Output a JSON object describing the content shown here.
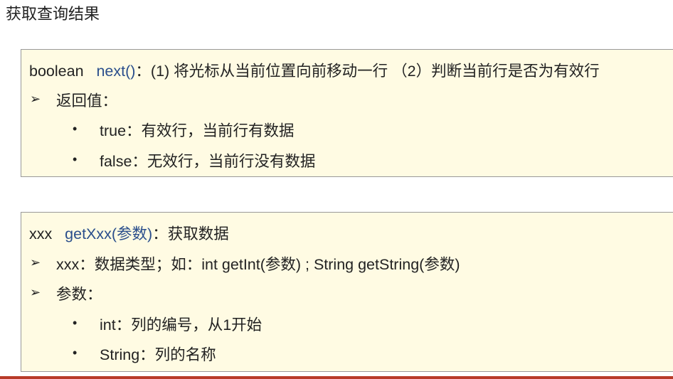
{
  "title": "获取查询结果",
  "box1": {
    "type": "boolean",
    "method": "next()",
    "desc": "：(1) 将光标从当前位置向前移动一行 （2）判断当前行是否为有效行",
    "section": "返回值：",
    "items": [
      "true：有效行，当前行有数据",
      "false：无效行，当前行没有数据"
    ]
  },
  "box2": {
    "type": "xxx",
    "method": "getXxx(参数)",
    "desc": "：获取数据",
    "line2": "xxx：数据类型；如：int getInt(参数) ; String getString(参数)",
    "section": "参数：",
    "items": [
      "int：列的编号，从1开始",
      "String：列的名称"
    ]
  },
  "icons": {
    "arrow": "➢",
    "bullet": "•"
  }
}
